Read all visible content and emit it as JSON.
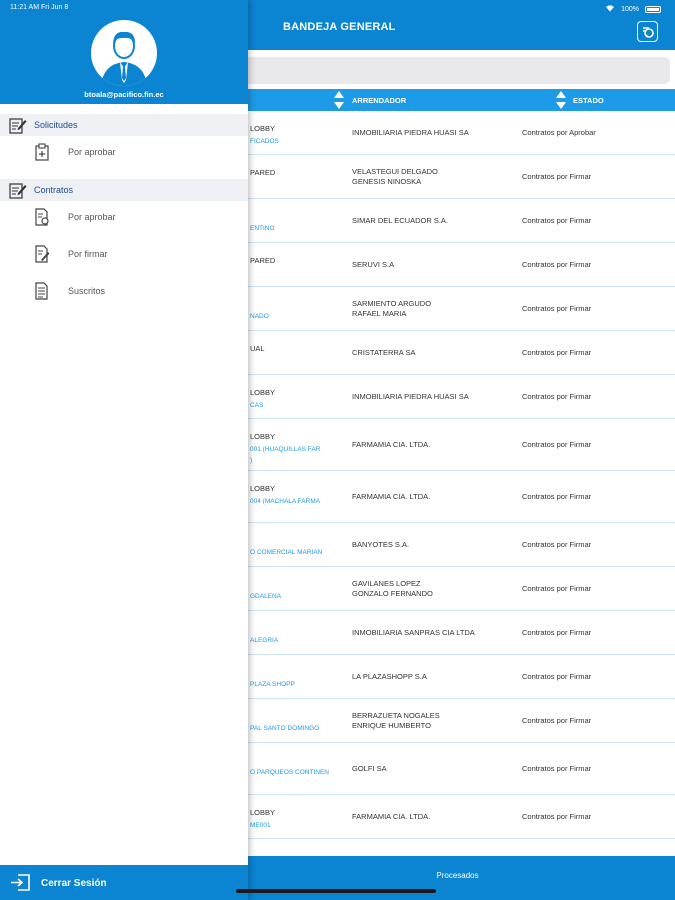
{
  "status_bar": {
    "time_date": "11:21 AM   Fri Jun 8",
    "battery": "100%"
  },
  "header": {
    "title": "BANDEJA GENERAL",
    "action_icon": "filter-document-icon"
  },
  "table": {
    "columns": [
      "ARRENDADOR",
      "ESTADO"
    ],
    "partial_column_fragment": "N",
    "rows": [
      {
        "l1": "LOBBY",
        "l2": "FICADOS",
        "arrendador": "INMOBILIARIA PIEDRA HUASI SA",
        "estado": "Contratos por Aprobar",
        "h": 44
      },
      {
        "l1": "PARED",
        "l2": "",
        "arrendador": "VELASTEGUI DELGADO\nGENESIS NINOSKA",
        "estado": "Contratos por Firmar",
        "h": 44
      },
      {
        "l1": "",
        "l2": "ENTINO",
        "arrendador": "SIMAR DEL ECUADOR S.A.",
        "estado": "Contratos por Firmar",
        "h": 44
      },
      {
        "l1": "PARED",
        "l2": "",
        "arrendador": "SERUVI S.A",
        "estado": "Contratos por Firmar",
        "h": 44
      },
      {
        "l1": "",
        "l2": "NADO",
        "arrendador": "SARMIENTO ARGUDO\nRAFAEL MARIA",
        "estado": "Contratos por Firmar",
        "h": 44
      },
      {
        "l1": "UAL",
        "l2": "",
        "arrendador": "CRISTATERRA SA",
        "estado": "Contratos por Firmar",
        "h": 44
      },
      {
        "l1": "LOBBY",
        "l2": "CAS",
        "arrendador": "INMOBILIARIA PIEDRA HUASI SA",
        "estado": "Contratos por Firmar",
        "h": 44
      },
      {
        "l1": "LOBBY",
        "l2": "001 (HUAQUILLAS FAR\n)",
        "arrendador": "FARMAMIA CIA. LTDA.",
        "estado": "Contratos por Firmar",
        "h": 52
      },
      {
        "l1": "LOBBY",
        "l2": "004 (MACHALA FARMA",
        "arrendador": "FARMAMIA CIA. LTDA.",
        "estado": "Contratos por Firmar",
        "h": 52
      },
      {
        "l1": "",
        "l2": "O COMERCIAL MARIAN",
        "arrendador": "BANYOTES S.A.",
        "estado": "Contratos por Firmar",
        "h": 44
      },
      {
        "l1": "",
        "l2": "GDALENA",
        "arrendador": "GAVILANES LOPEZ\nGONZALO FERNANDO",
        "estado": "Contratos por Firmar",
        "h": 44
      },
      {
        "l1": "",
        "l2": "ALEGRIA",
        "arrendador": "INMOBILIARIA SANPRAS CIA LTDA",
        "estado": "Contratos por Firmar",
        "h": 44
      },
      {
        "l1": "",
        "l2": "PLAZA SHOPP",
        "arrendador": "LA PLAZASHOPP S.A",
        "estado": "Contratos por Firmar",
        "h": 44
      },
      {
        "l1": "",
        "l2": "PAL SANTO DOMINGO",
        "arrendador": "BERRAZUETA NOGALES\nENRIQUE HUMBERTO",
        "estado": "Contratos por Firmar",
        "h": 44
      },
      {
        "l1": "",
        "l2": "O PARQUEOS CONTINEN",
        "arrendador": "GOLFI SA",
        "estado": "Contratos por Firmar",
        "h": 52
      },
      {
        "l1": "LOBBY",
        "l2": "ME001",
        "arrendador": "FARMAMIA CIA. LTDA.",
        "estado": "Contratos por Firmar",
        "h": 44
      }
    ]
  },
  "bottom_tab": {
    "label": "Procesados"
  },
  "drawer": {
    "email": "btoala@pacifico.fin.ec",
    "avatar_icon": "user-avatar-icon",
    "sections": [
      {
        "label": "Solicitudes",
        "icon": "document-edit-icon",
        "items": [
          {
            "label": "Por aprobar",
            "icon": "clipboard-icon"
          }
        ]
      },
      {
        "label": "Contratos",
        "icon": "document-edit-icon",
        "items": [
          {
            "label": "Por aprobar",
            "icon": "document-settings-icon"
          },
          {
            "label": "Por firmar",
            "icon": "document-sign-icon"
          },
          {
            "label": "Suscritos",
            "icon": "document-list-icon"
          }
        ]
      }
    ],
    "logout": {
      "label": "Cerrar Sesión",
      "icon": "logout-icon"
    }
  },
  "colors": {
    "primary": "#0b84d2",
    "header_row": "#1d9be6",
    "section_bg": "#eef0f3",
    "section_text": "#1a4f8f"
  }
}
